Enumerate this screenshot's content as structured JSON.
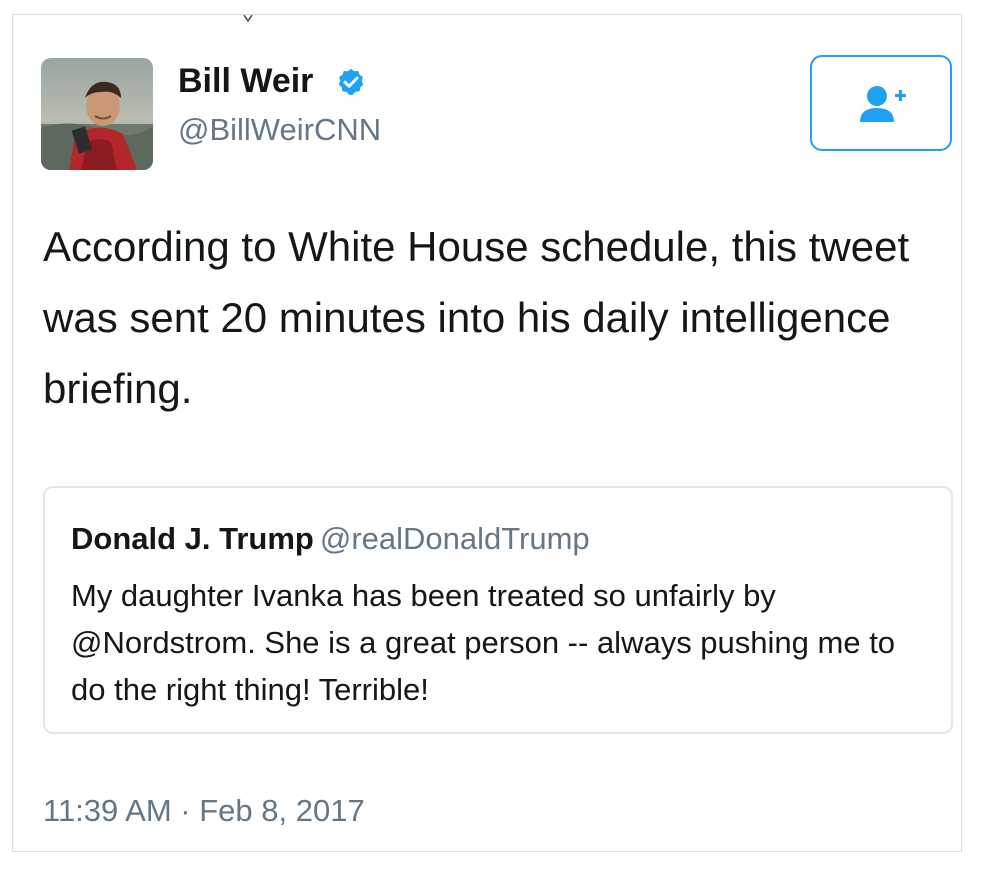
{
  "author": {
    "display_name": "Bill Weir",
    "handle": "@BillWeirCNN",
    "verified": true
  },
  "tweet": {
    "text": "According to White House schedule, this tweet was sent 20 minutes into his daily intelligence briefing.",
    "timestamp": "11:39 AM · Feb 8, 2017"
  },
  "quoted_tweet": {
    "display_name": "Donald J. Trump",
    "handle": "@realDonaldTrump",
    "text": "My daughter Ivanka has been treated so unfairly by @Nordstrom. She is a great person -- always pushing me to do the right thing! Terrible!"
  },
  "icons": {
    "verified": "verified-badge-icon",
    "follow": "follow-user-icon"
  },
  "colors": {
    "accent": "#1da1f2",
    "text_primary": "#14171a",
    "text_secondary": "#657786",
    "border": "#e1e8ed"
  }
}
